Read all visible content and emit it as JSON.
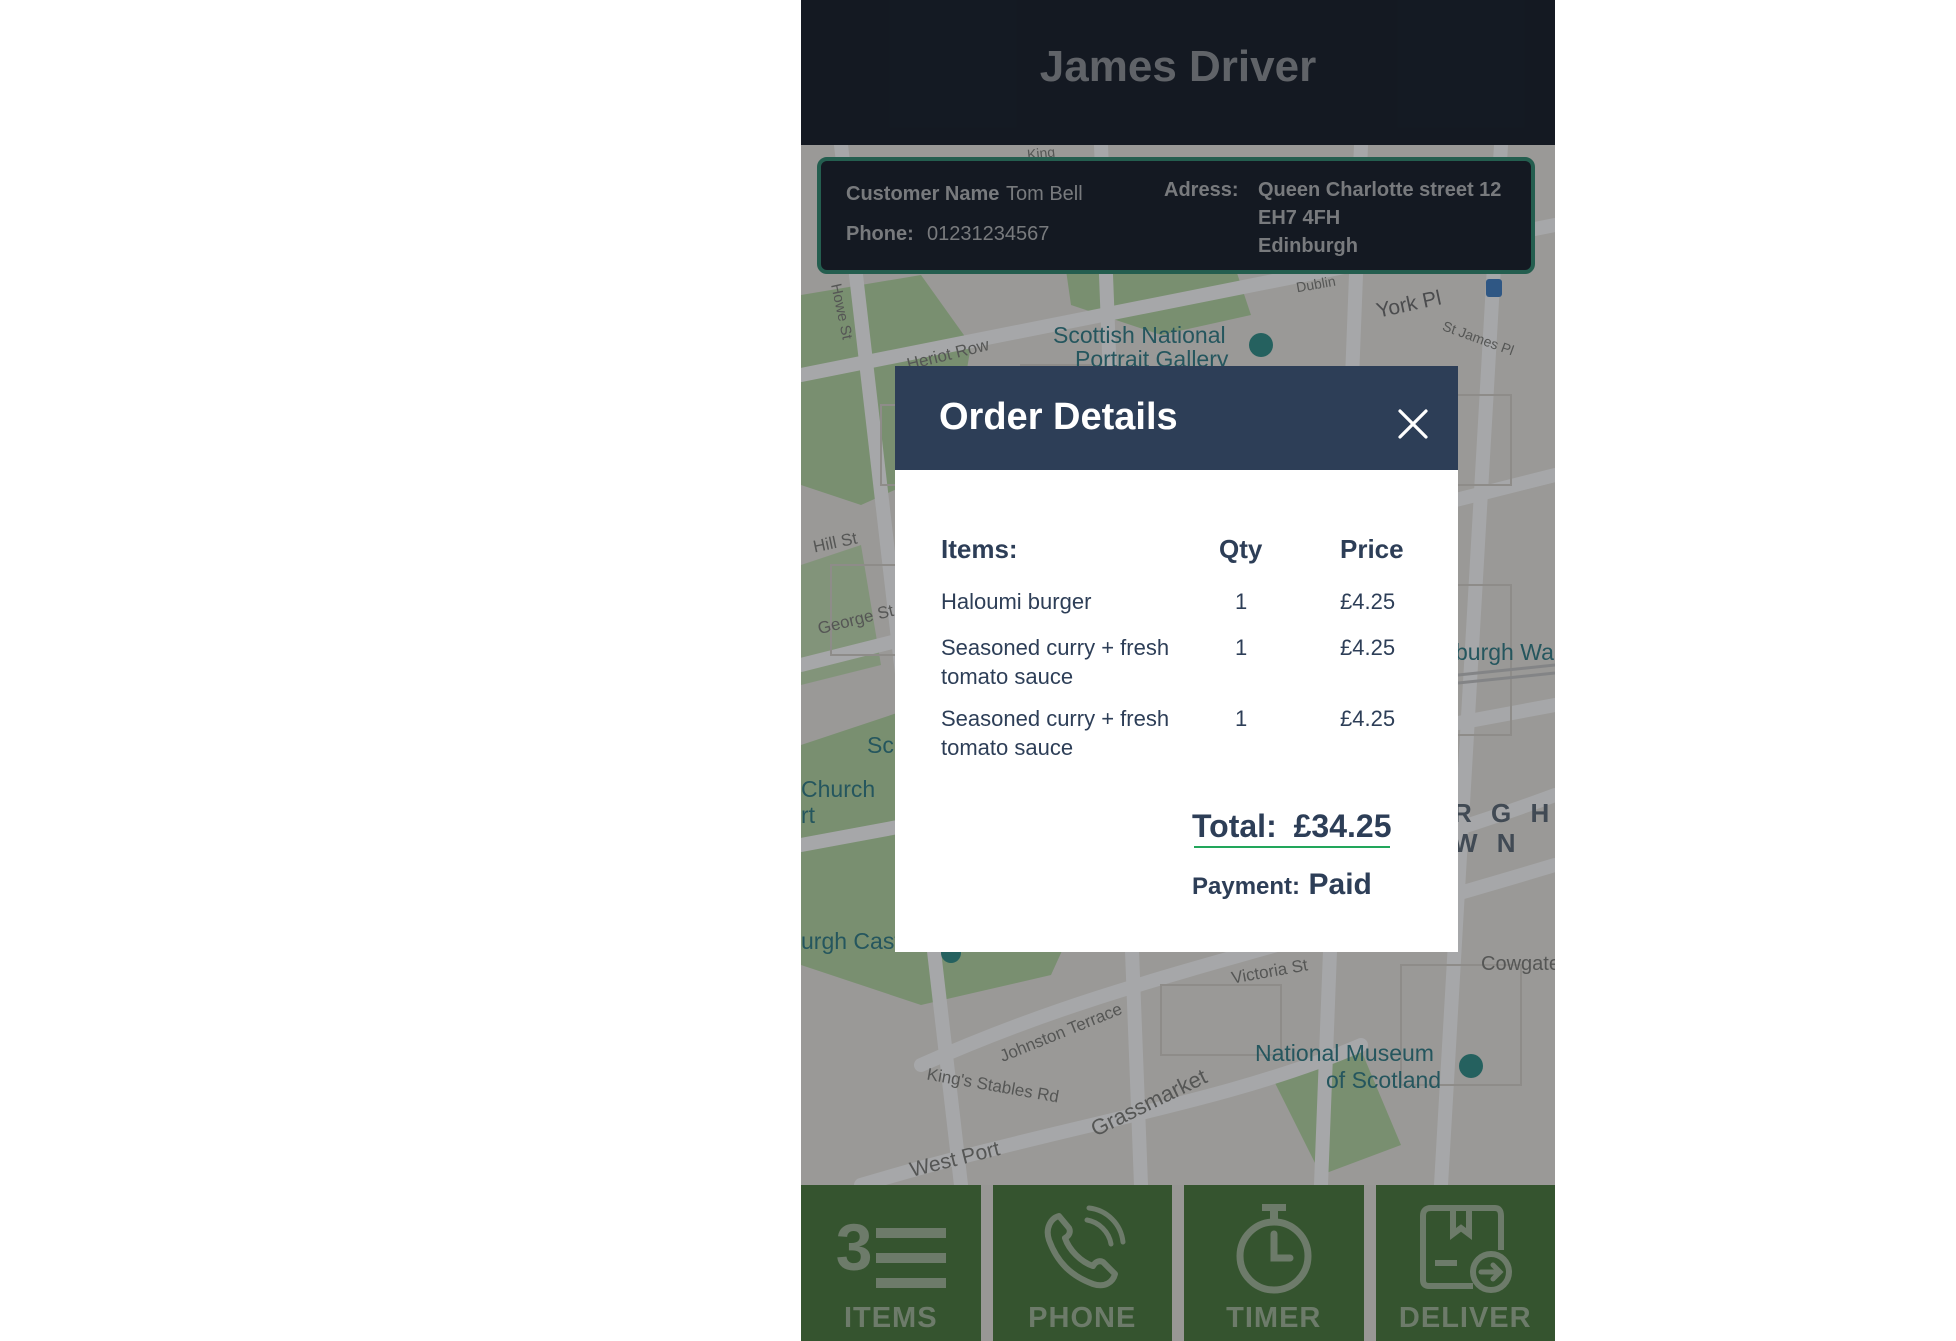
{
  "header": {
    "title": "James Driver"
  },
  "customer": {
    "name_label": "Customer Name",
    "name": "Tom Bell",
    "phone_label": "Phone:",
    "phone": "01231234567",
    "address_label": "Adress:",
    "address_line1": "Queen Charlotte  street 12",
    "address_line2": "EH7 4FH",
    "address_line3": "Edinburgh"
  },
  "map": {
    "labels": {
      "york_pl": "York Pl",
      "st_james_pl": "St James Pl",
      "heriot_row": "Heriot Row",
      "howe_st": "Howe St",
      "hill_st": "Hill St",
      "george_st": "George St",
      "scottish_portrait_1": "Scottish National",
      "scottish_portrait_2": "Portrait Gallery",
      "edinburgh_waverley": "burgh Wa",
      "sc": "Sc",
      "church_1": "Church",
      "church_2": "rt",
      "district_1": "R G H",
      "district_2": "W N",
      "castle": "urgh Castle",
      "victoria_st": "Victoria St",
      "cowgate": "Cowgate",
      "johnston_terrace": "Johnston Terrace",
      "kings_stables": "King's Stables Rd",
      "grassmarket": "Grassmarket",
      "museum_1": "National Museum",
      "museum_2": "of Scotland",
      "west_port": "West Port",
      "king": "King",
      "dublin": "Dublin"
    }
  },
  "modal": {
    "title": "Order Details",
    "columns": {
      "items": "Items:",
      "qty": "Qty",
      "price": "Price"
    },
    "items": [
      {
        "name_line1": "Haloumi burger",
        "name_line2": "",
        "qty": "1",
        "price": "£4.25"
      },
      {
        "name_line1": "Seasoned curry + fresh",
        "name_line2": "tomato sauce",
        "qty": "1",
        "price": "£4.25"
      },
      {
        "name_line1": "Seasoned curry + fresh",
        "name_line2": "tomato sauce",
        "qty": "1",
        "price": "£4.25"
      }
    ],
    "total_label": "Total:",
    "total_value": "£34.25",
    "payment_label": "Payment:",
    "payment_value": "Paid"
  },
  "nav": {
    "items_label": "ITEMS",
    "items_count": "3",
    "phone_label": "PHONE",
    "timer_label": "TIMER",
    "deliver_label": "DELIVER"
  },
  "colors": {
    "header_bg": "#141b26",
    "modal_header_bg": "#2d3e57",
    "nav_green": "#4a7a3a",
    "accent_green": "#22a65b"
  }
}
